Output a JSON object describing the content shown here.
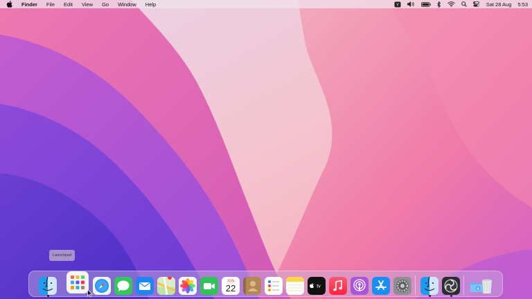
{
  "menubar": {
    "app_name": "Finder",
    "menus": [
      "File",
      "Edit",
      "View",
      "Go",
      "Window",
      "Help"
    ],
    "status": {
      "date": "Sat 28 Aug",
      "time": "5:53",
      "icons": [
        "yubico-icon",
        "volume-icon",
        "battery-icon",
        "bluetooth-icon",
        "wifi-icon",
        "search-icon",
        "control-center-icon"
      ]
    }
  },
  "tooltip": {
    "label": "Launchpad"
  },
  "dock": {
    "apps": [
      {
        "name": "Finder",
        "icon": "finder-icon",
        "running": true
      },
      {
        "name": "Launchpad",
        "icon": "launchpad-icon",
        "running": false
      },
      {
        "name": "Safari",
        "icon": "safari-icon",
        "running": false
      },
      {
        "name": "Messages",
        "icon": "messages-icon",
        "running": false
      },
      {
        "name": "Mail",
        "icon": "mail-icon",
        "running": false
      },
      {
        "name": "Maps",
        "icon": "maps-icon",
        "running": false
      },
      {
        "name": "Photos",
        "icon": "photos-icon",
        "running": false
      },
      {
        "name": "FaceTime",
        "icon": "facetime-icon",
        "running": false
      },
      {
        "name": "Calendar",
        "icon": "calendar-icon",
        "running": false,
        "month": "JUN",
        "day": "22"
      },
      {
        "name": "Contacts",
        "icon": "contacts-icon",
        "running": false
      },
      {
        "name": "Reminders",
        "icon": "reminders-icon",
        "running": false
      },
      {
        "name": "Notes",
        "icon": "notes-icon",
        "running": false
      },
      {
        "name": "TV",
        "icon": "tv-icon",
        "running": false,
        "label": "tv"
      },
      {
        "name": "Music",
        "icon": "music-icon",
        "running": false
      },
      {
        "name": "Podcasts",
        "icon": "podcasts-icon",
        "running": false
      },
      {
        "name": "App Store",
        "icon": "app-store-icon",
        "running": false
      },
      {
        "name": "System Preferences",
        "icon": "system-preferences-icon",
        "running": false
      },
      {
        "name": "Finder",
        "icon": "finder-icon",
        "running": true
      },
      {
        "name": "OBS",
        "icon": "obs-icon",
        "running": true
      },
      {
        "name": "Downloads",
        "icon": "downloads-folder-icon",
        "running": false
      },
      {
        "name": "Trash",
        "icon": "trash-icon",
        "running": false
      }
    ]
  },
  "colors": {
    "accent": "#e85fb5",
    "dock_bg": "#c8b9e1",
    "menubar_bg": "#f0e1eb"
  }
}
